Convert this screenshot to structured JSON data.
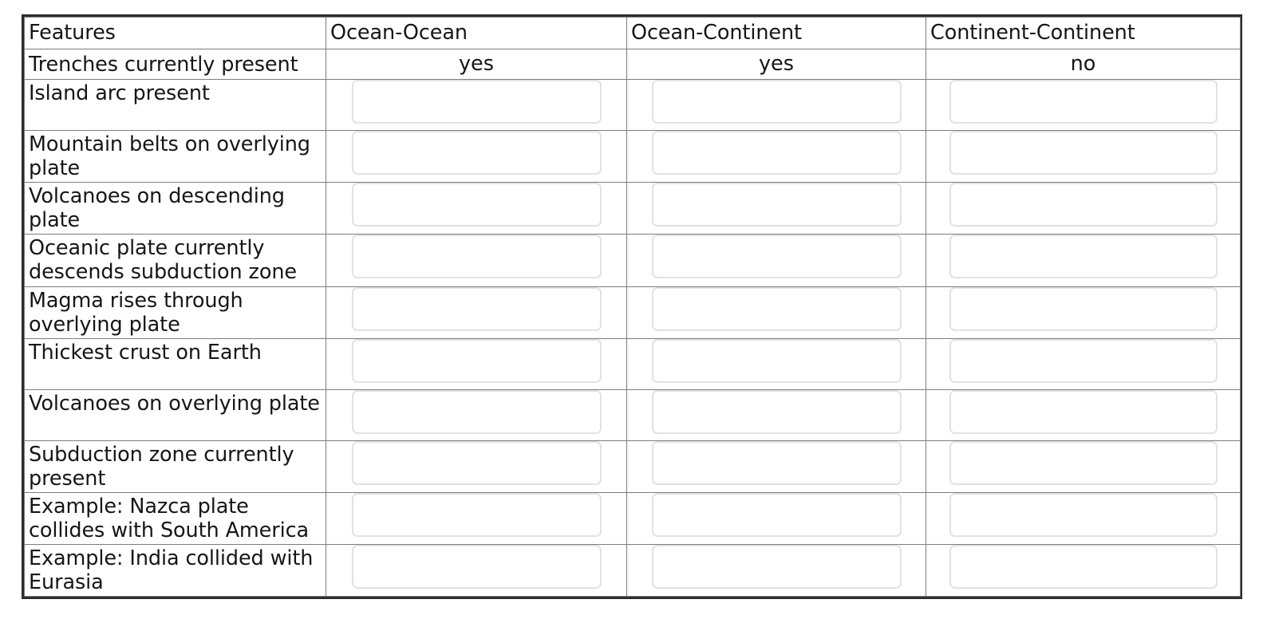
{
  "table": {
    "columns": [
      "Features",
      "Ocean-Ocean",
      "Ocean-Continent",
      "Continent-Continent"
    ],
    "answered_row": {
      "feature": "Trenches currently present",
      "values": [
        "yes",
        "yes",
        "no"
      ]
    },
    "rows": [
      {
        "feature": "Island arc present",
        "values": [
          "",
          "",
          ""
        ]
      },
      {
        "feature": "Mountain belts on overlying plate",
        "values": [
          "",
          "",
          ""
        ]
      },
      {
        "feature": "Volcanoes on descending plate",
        "values": [
          "",
          "",
          ""
        ]
      },
      {
        "feature": "Oceanic plate currently descends subduction zone",
        "values": [
          "",
          "",
          ""
        ]
      },
      {
        "feature": "Magma rises through overlying plate",
        "values": [
          "",
          "",
          ""
        ]
      },
      {
        "feature": "Thickest crust on Earth",
        "values": [
          "",
          "",
          ""
        ]
      },
      {
        "feature": "Volcanoes on overlying plate",
        "values": [
          "",
          "",
          ""
        ]
      },
      {
        "feature": "Subduction zone currently present",
        "values": [
          "",
          "",
          ""
        ]
      },
      {
        "feature": "Example: Nazca plate collides with South America",
        "values": [
          "",
          "",
          ""
        ]
      },
      {
        "feature": "Example: India collided with Eurasia",
        "values": [
          "",
          "",
          ""
        ]
      }
    ]
  },
  "colors": {
    "outer_border": "#2d2d2d",
    "inner_border": "#7d7d7d",
    "input_border": "#e2e2e2",
    "text": "#161616",
    "background": "#ffffff"
  }
}
